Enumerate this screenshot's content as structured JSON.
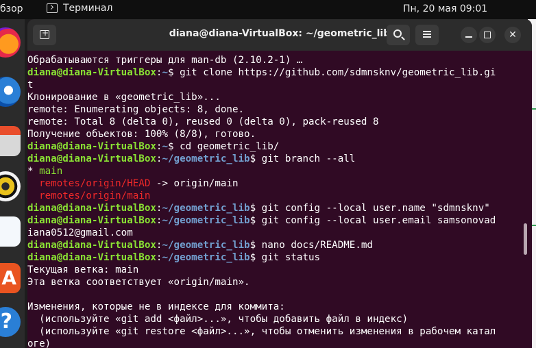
{
  "topbar": {
    "activities": "бзор",
    "app_name": "Терминал",
    "clock": "Пн, 20 мая  09:01"
  },
  "dock": {
    "items": [
      "firefox-icon",
      "thunderbird-icon",
      "files-icon",
      "rhythmbox-icon",
      "libreoffice-writer-icon",
      "app-center-icon",
      "help-icon"
    ],
    "store_glyph": "A",
    "help_glyph": "?"
  },
  "window": {
    "title": "diana@diana-VirtualBox: ~/geometric_lib",
    "close_glyph": "✕"
  },
  "terminal": {
    "prompt_user": "diana@diana-VirtualBox",
    "lines": [
      {
        "text": "Обрабатываются триггеры для man-db (2.10.2-1) …"
      },
      {
        "path": "~",
        "cmd": "$ git clone https://github.com/sdmnsknv/geometric_lib.gi"
      },
      {
        "text": "t"
      },
      {
        "text": "Клонирование в «geometric_lib»..."
      },
      {
        "text": "remote: Enumerating objects: 8, done."
      },
      {
        "text": "remote: Total 8 (delta 0), reused 0 (delta 0), pack-reused 8"
      },
      {
        "text": "Получение объектов: 100% (8/8), готово."
      },
      {
        "path": "~",
        "cmd": "$ cd geometric_lib/"
      },
      {
        "path": "~/geometric_lib",
        "cmd": "$ git branch --all"
      },
      {
        "text": "* main"
      },
      {
        "text": "  remotes/origin/HEAD -> origin/main"
      },
      {
        "text": "  remotes/origin/main"
      },
      {
        "path": "~/geometric_lib",
        "cmd": "$ git config --local user.name \"sdmnsknv\""
      },
      {
        "path": "~/geometric_lib",
        "cmd": "$ git config --local user.email samsonovad"
      },
      {
        "text": "iana0512@gmail.com"
      },
      {
        "path": "~/geometric_lib",
        "cmd": "$ nano docs/README.md"
      },
      {
        "path": "~/geometric_lib",
        "cmd": "$ git status"
      },
      {
        "text": "Текущая ветка: main"
      },
      {
        "text": "Эта ветка соответствует «origin/main»."
      },
      {
        "text": ""
      },
      {
        "text": "Изменения, которые не в индексе для коммита:"
      },
      {
        "text": "  (используйте «git add <файл>...», чтобы добавить файл в индекс)"
      },
      {
        "text": "  (используйте «git restore <файл>...», чтобы отменить изменения в рабочем катал"
      },
      {
        "text": "оге)"
      }
    ]
  },
  "colors": {
    "terminal_bg": "#300a24",
    "prompt_user": "#8ae234",
    "prompt_path": "#729fcf",
    "remote_branch": "#ef2929",
    "current_branch": "#8ae234"
  }
}
